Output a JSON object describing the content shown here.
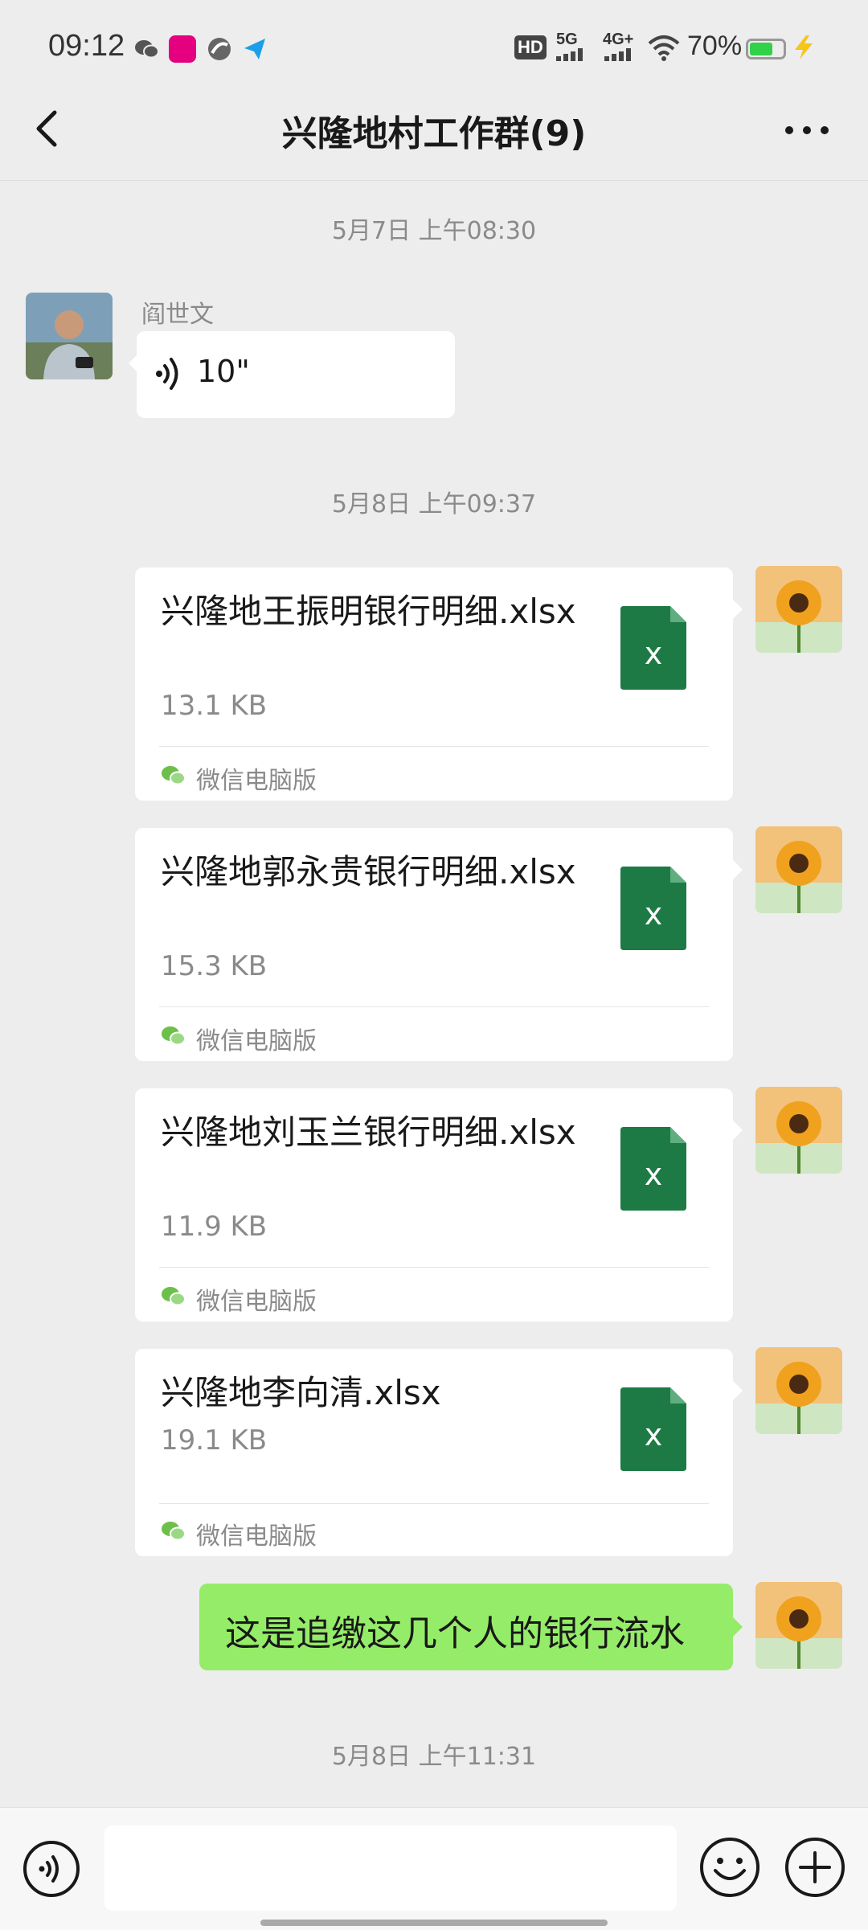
{
  "status_bar": {
    "time": "09:12",
    "hd": "HD",
    "network_5g": "5G",
    "network_4g": "4G+",
    "battery_percent": "70%",
    "battery_level": 0.7,
    "icons": [
      "wechat-icon",
      "shopping-app-icon",
      "browser-app-icon",
      "send-app-icon",
      "hd-icon",
      "signal-5g-icon",
      "signal-4g-icon",
      "wifi-icon",
      "battery-icon",
      "charging-icon"
    ]
  },
  "header": {
    "title": "兴隆地村工作群(9)",
    "back_icon": "back-arrow-icon",
    "more_icon": "more-dots-icon"
  },
  "messages": {
    "time_1": "5月7日 上午08:30",
    "voice": {
      "sender": "阎世文",
      "duration": "10\""
    },
    "time_2": "5月8日 上午09:37",
    "files": [
      {
        "name": "兴隆地王振明银行明细.xlsx",
        "size": "13.1 KB",
        "source": "微信电脑版",
        "icon": "excel-file-icon"
      },
      {
        "name": "兴隆地郭永贵银行明细.xlsx",
        "size": "15.3 KB",
        "source": "微信电脑版",
        "icon": "excel-file-icon"
      },
      {
        "name": "兴隆地刘玉兰银行明细.xlsx",
        "size": "11.9 KB",
        "source": "微信电脑版",
        "icon": "excel-file-icon"
      },
      {
        "name": "兴隆地李向清.xlsx",
        "size": "19.1 KB",
        "source": "微信电脑版",
        "icon": "excel-file-icon"
      }
    ],
    "text": "这是追缴这几个人的银行流水",
    "time_3": "5月8日 上午11:31"
  },
  "input_bar": {
    "placeholder": "",
    "icons": [
      "voice-input-icon",
      "emoji-icon",
      "plus-icon"
    ]
  },
  "colors": {
    "background": "#ededed",
    "my_bubble": "#95ec69",
    "excel_green": "#1d7a45"
  }
}
